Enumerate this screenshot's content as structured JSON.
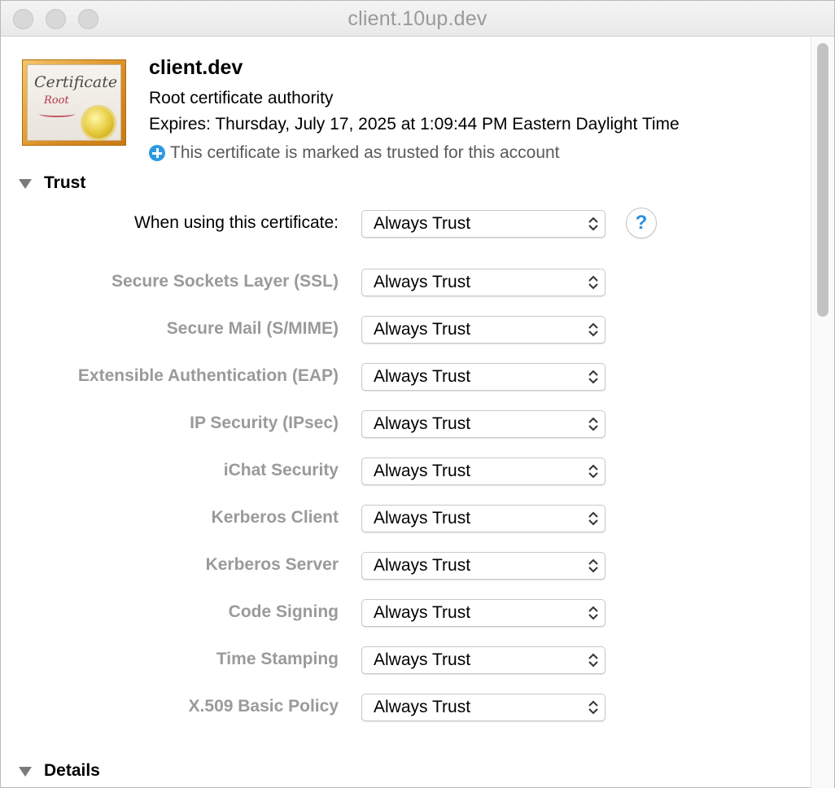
{
  "window": {
    "title": "client.10up.dev"
  },
  "certificate": {
    "icon_word": "Certificate",
    "icon_sub": "Root",
    "name": "client.dev",
    "kind": "Root certificate authority",
    "expires": "Expires: Thursday, July 17, 2025 at 1:09:44 PM Eastern Daylight Time",
    "trust_status": "This certificate is marked as trusted for this account"
  },
  "trust": {
    "section_label": "Trust",
    "when_using_label": "When using this certificate:",
    "when_using_value": "Always Trust",
    "help_label": "?",
    "rows": [
      {
        "label": "Secure Sockets Layer (SSL)",
        "value": "Always Trust"
      },
      {
        "label": "Secure Mail (S/MIME)",
        "value": "Always Trust"
      },
      {
        "label": "Extensible Authentication (EAP)",
        "value": "Always Trust"
      },
      {
        "label": "IP Security (IPsec)",
        "value": "Always Trust"
      },
      {
        "label": "iChat Security",
        "value": "Always Trust"
      },
      {
        "label": "Kerberos Client",
        "value": "Always Trust"
      },
      {
        "label": "Kerberos Server",
        "value": "Always Trust"
      },
      {
        "label": "Code Signing",
        "value": "Always Trust"
      },
      {
        "label": "Time Stamping",
        "value": "Always Trust"
      },
      {
        "label": "X.509 Basic Policy",
        "value": "Always Trust"
      }
    ]
  },
  "details": {
    "section_label": "Details"
  },
  "colors": {
    "accent": "#2d9ae0",
    "dim_label": "#9a9a9a"
  },
  "icons": [
    "certificate-icon",
    "plus-icon",
    "disclosure-triangle-icon",
    "updown-arrows-icon",
    "help-icon"
  ]
}
